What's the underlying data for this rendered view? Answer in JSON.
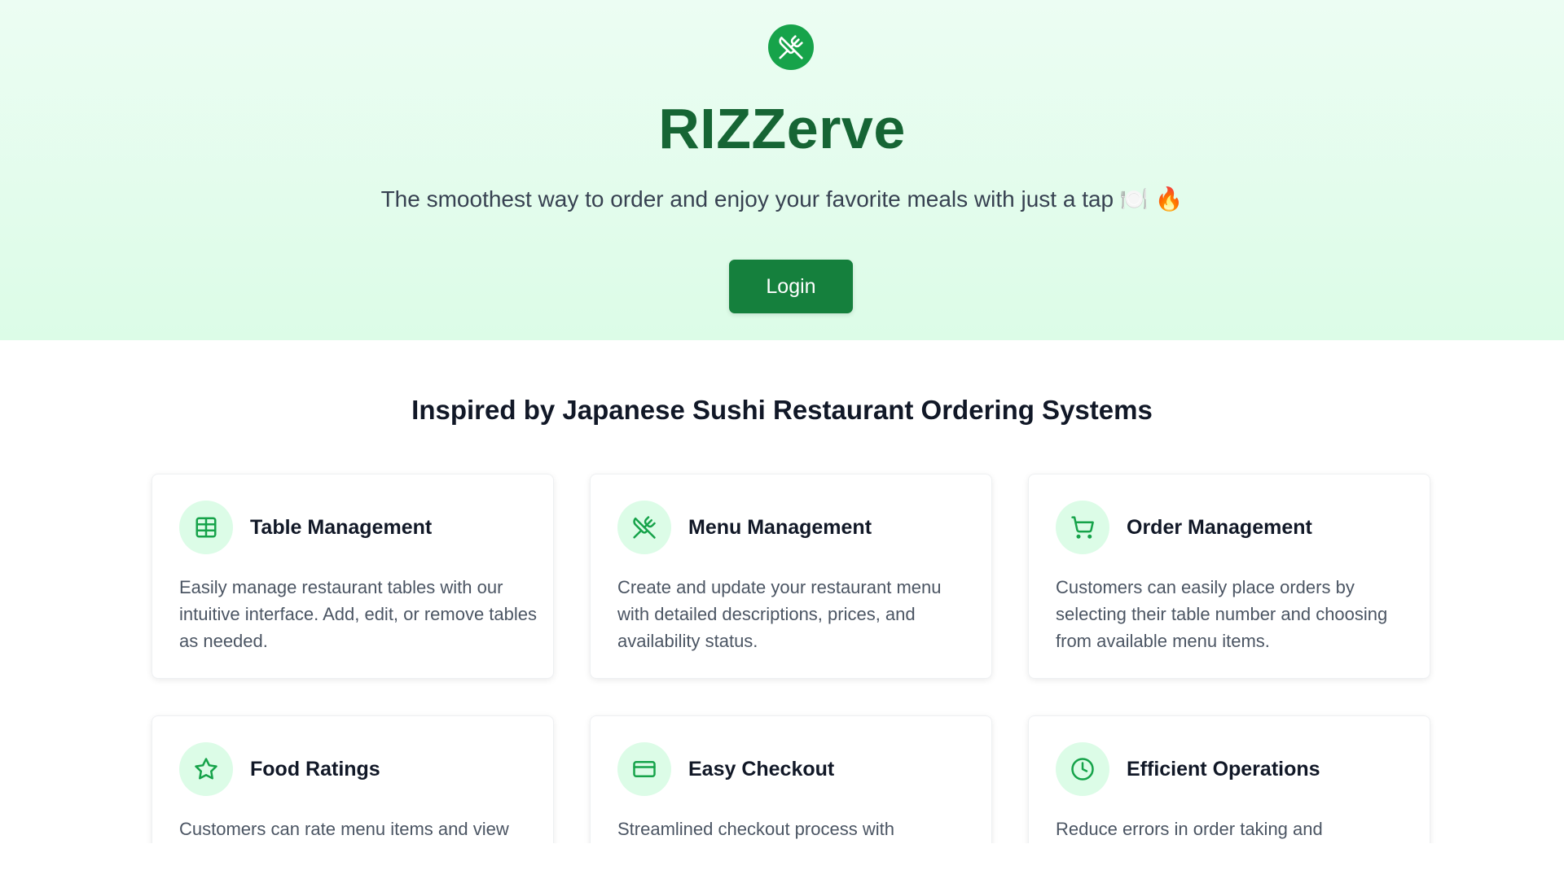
{
  "hero": {
    "brand": "RIZZerve",
    "tagline": "The smoothest way to order and enjoy your favorite meals with just a tap 🍽️ 🔥",
    "login_label": "Login",
    "logo_icon": "utensils-crossed-icon"
  },
  "features": {
    "title": "Inspired by Japanese Sushi Restaurant Ordering Systems",
    "cards": [
      {
        "icon": "table-grid-icon",
        "title": "Table Management",
        "desc": "Easily manage restaurant tables with our intuitive interface. Add, edit, or remove tables as needed."
      },
      {
        "icon": "utensils-crossed-icon",
        "title": "Menu Management",
        "desc": "Create and update your restaurant menu with detailed descriptions, prices, and availability status."
      },
      {
        "icon": "shopping-cart-icon",
        "title": "Order Management",
        "desc": "Customers can easily place orders by selecting their table number and choosing from available menu items."
      },
      {
        "icon": "star-icon",
        "title": "Food Ratings",
        "desc": "Customers can rate menu items and view"
      },
      {
        "icon": "credit-card-icon",
        "title": "Easy Checkout",
        "desc": "Streamlined checkout process with"
      },
      {
        "icon": "clock-icon",
        "title": "Efficient Operations",
        "desc": "Reduce errors in order taking and"
      }
    ]
  },
  "colors": {
    "brand_green": "#166534",
    "button_green": "#15803d",
    "icon_green": "#16a34a",
    "icon_bg": "#dcfce7",
    "hero_bg_top": "#ecfdf3",
    "hero_bg_bottom": "#dcfce7"
  }
}
